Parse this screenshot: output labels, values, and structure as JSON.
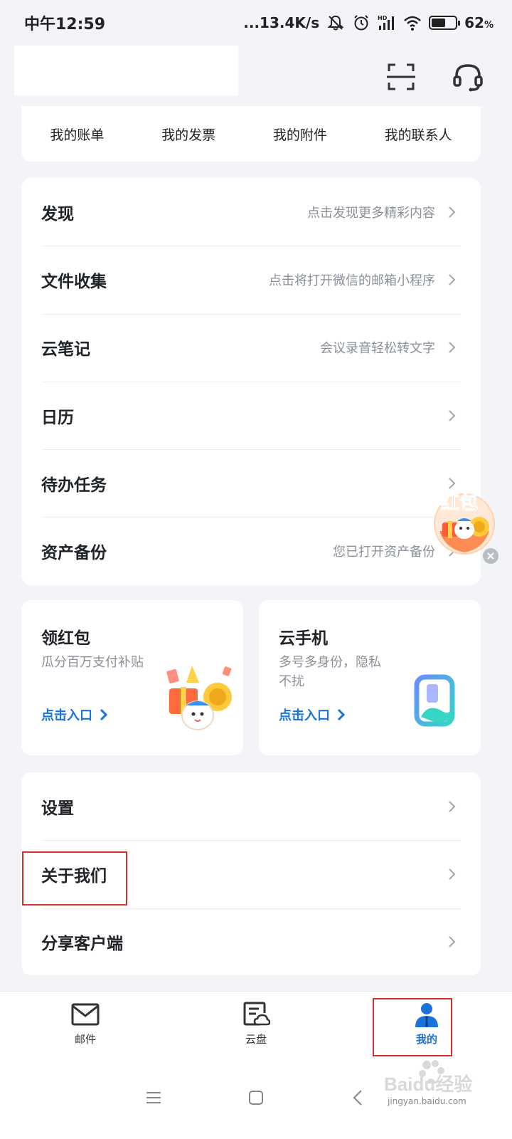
{
  "status_bar": {
    "time": "中午12:59",
    "network_speed": "...13.4K/s",
    "hd_badge": "HD",
    "battery_percent": "62",
    "battery_unit": "%",
    "battery_level": 0.62
  },
  "header": {
    "scan_icon": "scan-icon",
    "support_icon": "headset-icon"
  },
  "quick_links": [
    "我的账单",
    "我的发票",
    "我的附件",
    "我的联系人"
  ],
  "feature_list": [
    {
      "title": "发现",
      "desc": "点击发现更多精彩内容"
    },
    {
      "title": "文件收集",
      "desc": "点击将打开微信的邮箱小程序"
    },
    {
      "title": "云笔记",
      "desc": "会议录音轻松转文字"
    },
    {
      "title": "日历",
      "desc": ""
    },
    {
      "title": "待办任务",
      "desc": ""
    },
    {
      "title": "资产备份",
      "desc": "您已打开资产备份"
    }
  ],
  "promos": [
    {
      "title": "领红包",
      "desc": "瓜分百万支付补贴",
      "link": "点击入口"
    },
    {
      "title": "云手机",
      "desc": "多号多身份，隐私不扰",
      "link": "点击入口"
    }
  ],
  "floating_badge": {
    "label": "红包"
  },
  "settings_list": [
    {
      "title": "设置"
    },
    {
      "title": "关于我们"
    },
    {
      "title": "分享客户端"
    }
  ],
  "tabs": [
    {
      "label": "邮件",
      "icon": "mail-icon",
      "active": false
    },
    {
      "label": "云盘",
      "icon": "cloud-drive-icon",
      "active": false
    },
    {
      "label": "我的",
      "icon": "profile-icon",
      "active": true
    }
  ],
  "colors": {
    "accent": "#1a73d9",
    "highlight": "#d32f2f",
    "background": "#f2f4f8"
  },
  "watermark": {
    "text": "Baidu经验",
    "sub": "jingyan.baidu.com"
  }
}
